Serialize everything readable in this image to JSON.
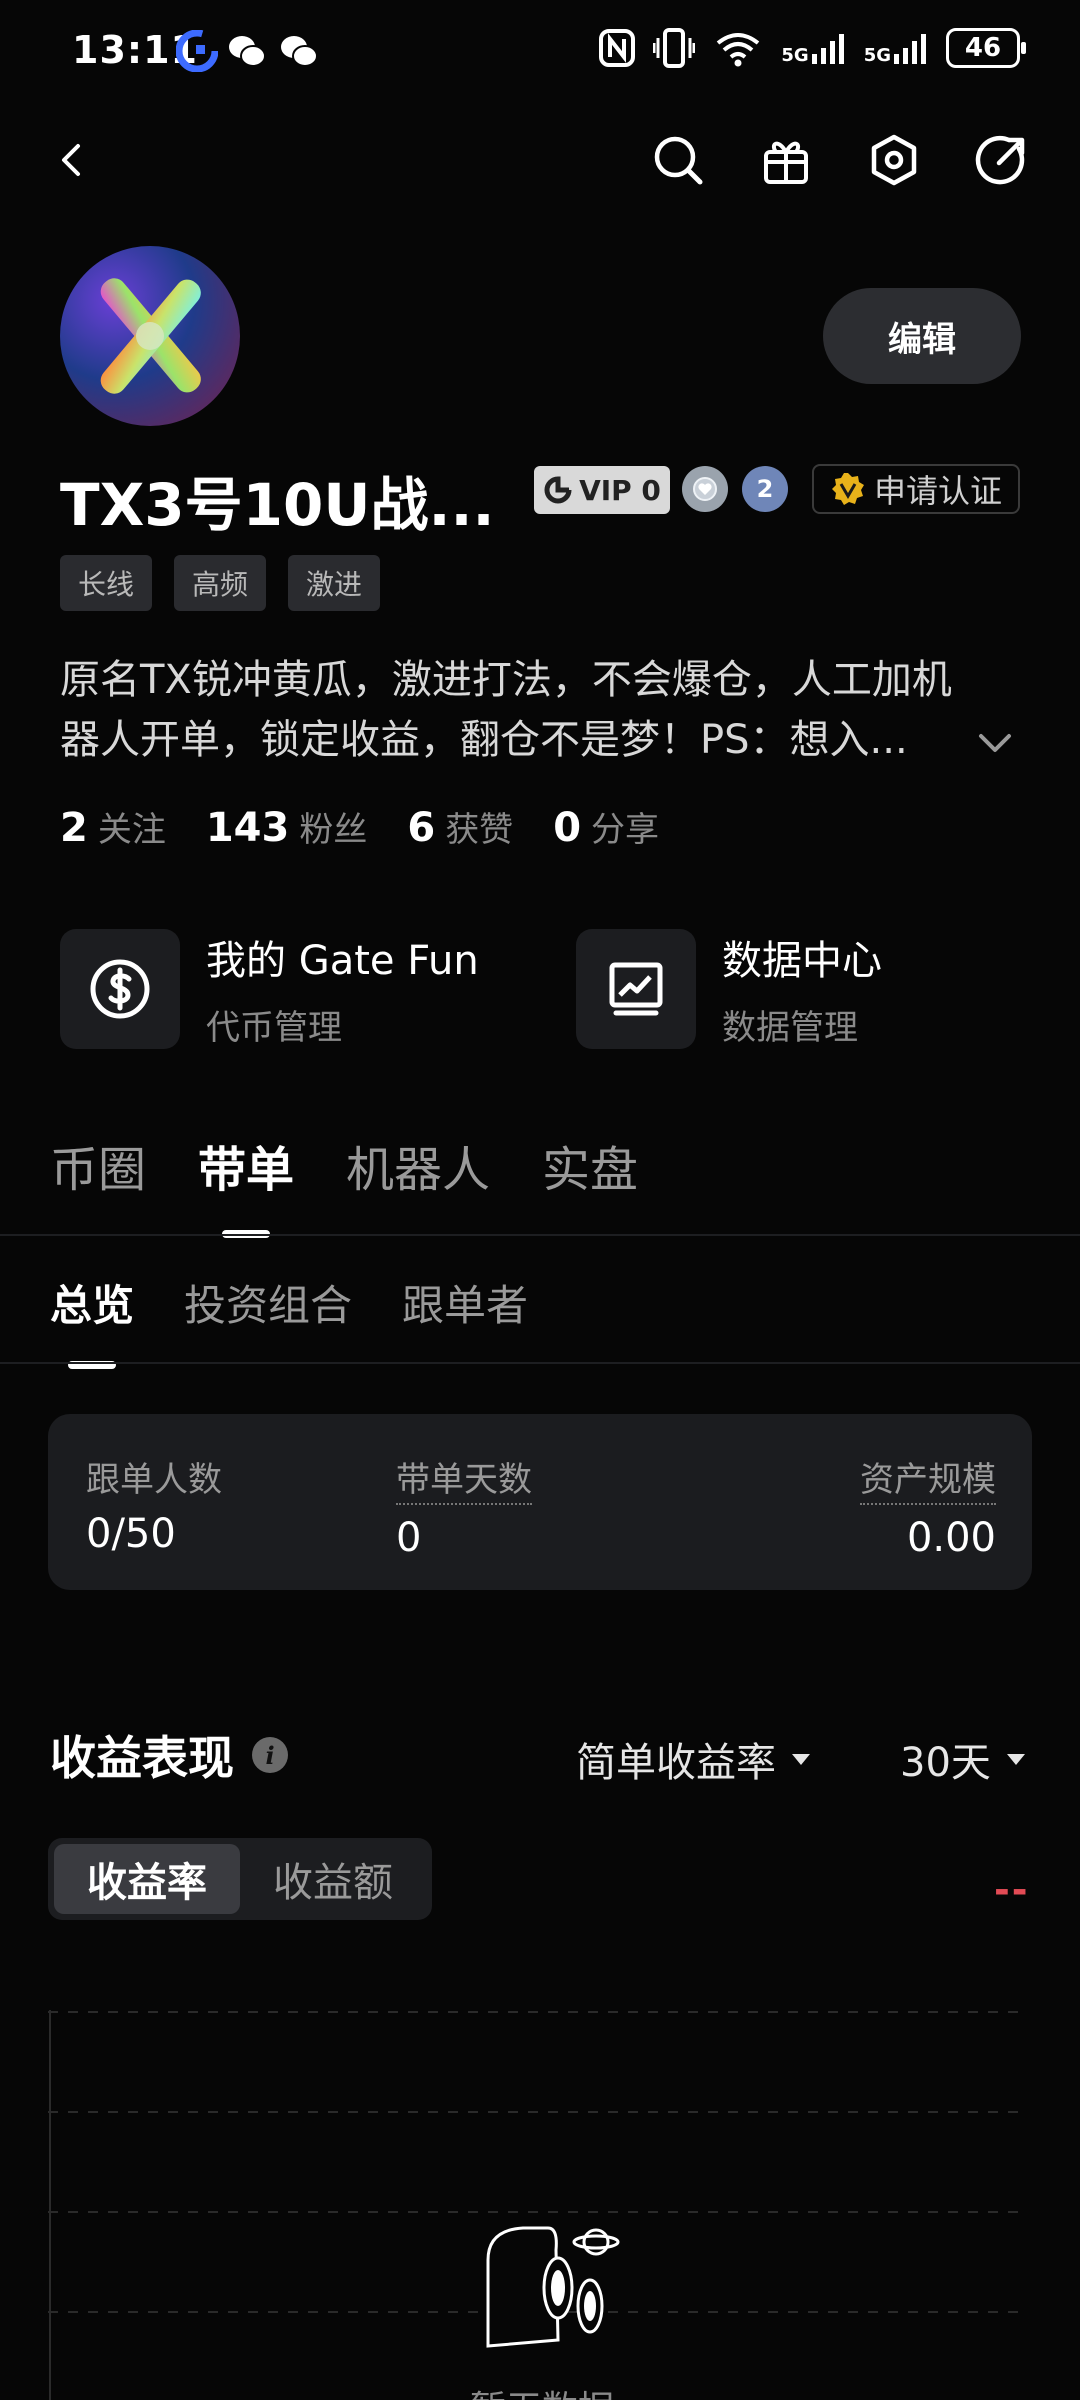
{
  "status_bar": {
    "time": "13:11",
    "network_5g_a": "5G",
    "network_5g_b": "5G",
    "battery": "46"
  },
  "profile": {
    "username": "TX3号10U战...",
    "vip_label": "VIP 0",
    "level_badge": "2",
    "verify_label": "申请认证",
    "edit_label": "编辑",
    "tags": [
      "长线",
      "高频",
      "激进"
    ],
    "bio_line1": "原名TX锐冲黄瓜，激进打法，不会爆仓，人工加机",
    "bio_line2": "器人开单，锁定收益，翻仓不是梦！PS：想入...",
    "stats": [
      {
        "num": "2",
        "label": "关注"
      },
      {
        "num": "143",
        "label": "粉丝"
      },
      {
        "num": "6",
        "label": "获赞"
      },
      {
        "num": "0",
        "label": "分享"
      }
    ]
  },
  "features": [
    {
      "title": "我的 Gate Fun",
      "sub": "代币管理",
      "icon": "dollar-icon"
    },
    {
      "title": "数据中心",
      "sub": "数据管理",
      "icon": "chart-monitor-icon"
    }
  ],
  "main_tabs": [
    "币圈",
    "带单",
    "机器人",
    "实盘"
  ],
  "sub_tabs": [
    "总览",
    "投资组合",
    "跟单者"
  ],
  "overview": {
    "followers_label": "跟单人数",
    "followers_value": "0/50",
    "days_label": "带单天数",
    "days_value": "0",
    "aum_label": "资产规模",
    "aum_value": "0.00"
  },
  "returns": {
    "title": "收益表现",
    "mode_dropdown": "简单收益率",
    "period_dropdown": "30天",
    "toggle_rate": "收益率",
    "toggle_amount": "收益额",
    "value_placeholder": "--",
    "empty_text": "暂无数据"
  },
  "colors": {
    "background": "#060606",
    "card": "#1b1c1f",
    "negative": "#e24b55",
    "muted": "#8a8a8a"
  }
}
